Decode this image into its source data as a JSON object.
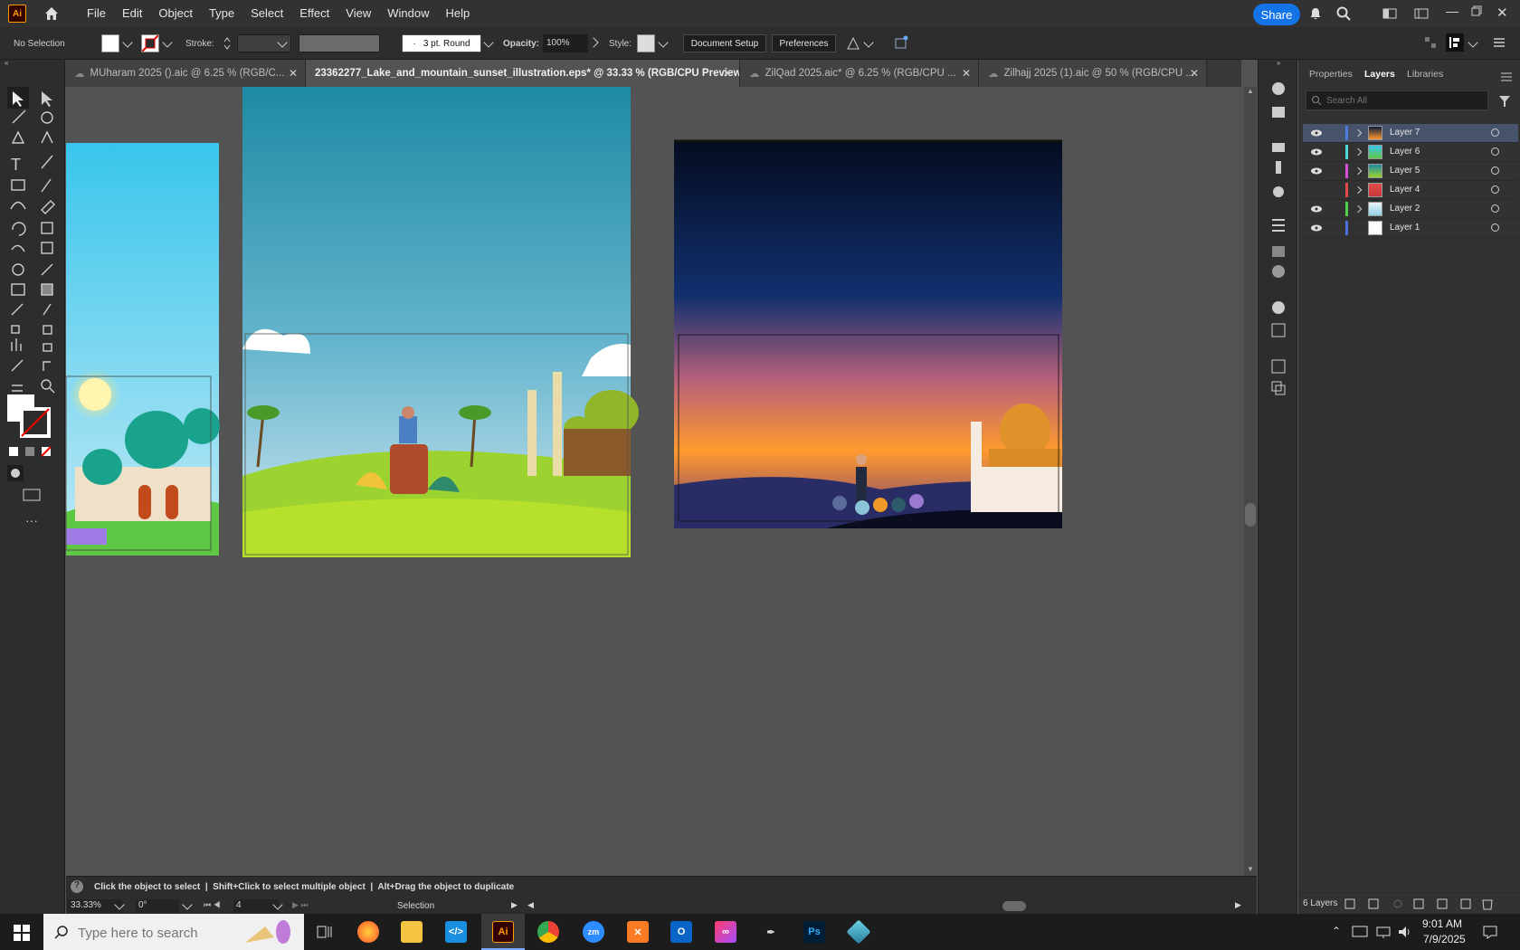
{
  "app": {
    "logo": "Ai",
    "menus": [
      "File",
      "Edit",
      "Object",
      "Type",
      "Select",
      "Effect",
      "View",
      "Window",
      "Help"
    ],
    "share_label": "Share"
  },
  "control": {
    "selection": "No Selection",
    "stroke_label": "Stroke:",
    "brush_label": "3 pt. Round",
    "opacity_label": "Opacity:",
    "opacity_value": "100%",
    "style_label": "Style:",
    "doc_setup": "Document Setup",
    "preferences": "Preferences"
  },
  "tabs": [
    {
      "label": "MUharam 2025 ().aic @ 6.25 % (RGB/C...",
      "active": false,
      "cloud": true
    },
    {
      "label": "23362277_Lake_and_mountain_sunset_illustration.eps* @ 33.33 % (RGB/CPU Preview)",
      "active": true,
      "cloud": false
    },
    {
      "label": "ZilQad 2025.aic* @ 6.25 % (RGB/CPU ...",
      "active": false,
      "cloud": true
    },
    {
      "label": "Zilhajj 2025 (1).aic @ 50 % (RGB/CPU ...",
      "active": false,
      "cloud": true
    }
  ],
  "panel": {
    "tabs": [
      "Properties",
      "Layers",
      "Libraries"
    ],
    "active_tab": "Layers",
    "search_placeholder": "Search All",
    "layers": [
      {
        "name": "Layer 7",
        "visible": true,
        "color": "#4f7bde",
        "selected": true
      },
      {
        "name": "Layer 6",
        "visible": true,
        "color": "#4fd8d8",
        "selected": false
      },
      {
        "name": "Layer 5",
        "visible": true,
        "color": "#d64fd6",
        "selected": false
      },
      {
        "name": "Layer 4",
        "visible": false,
        "color": "#e24a4a",
        "selected": false
      },
      {
        "name": "Layer 2",
        "visible": true,
        "color": "#4fd04f",
        "selected": false
      },
      {
        "name": "Layer 1",
        "visible": true,
        "color": "#4f6ee0",
        "selected": false
      }
    ],
    "layer_count": "6 Layers"
  },
  "status": {
    "hint": "Click the object to select  |  Shift+Click to select multiple object  |  Alt+Drag the object to duplicate",
    "zoom": "33.33%",
    "rotation": "0°",
    "artboard": "4",
    "tool": "Selection"
  },
  "taskbar": {
    "search_placeholder": "Type here to search",
    "time": "9:01 AM",
    "date": "7/9/2025",
    "apps": [
      "task-view",
      "firefox",
      "file-explorer",
      "vscode",
      "illustrator",
      "chrome",
      "zoom",
      "xampp",
      "outlook",
      "creative-cloud",
      "pen-tool",
      "photoshop",
      "app"
    ]
  },
  "colors": {
    "accent": "#1473e6",
    "ai_orange": "#ff9a00",
    "panel_bg": "#323232",
    "canvas_bg": "#535353"
  }
}
